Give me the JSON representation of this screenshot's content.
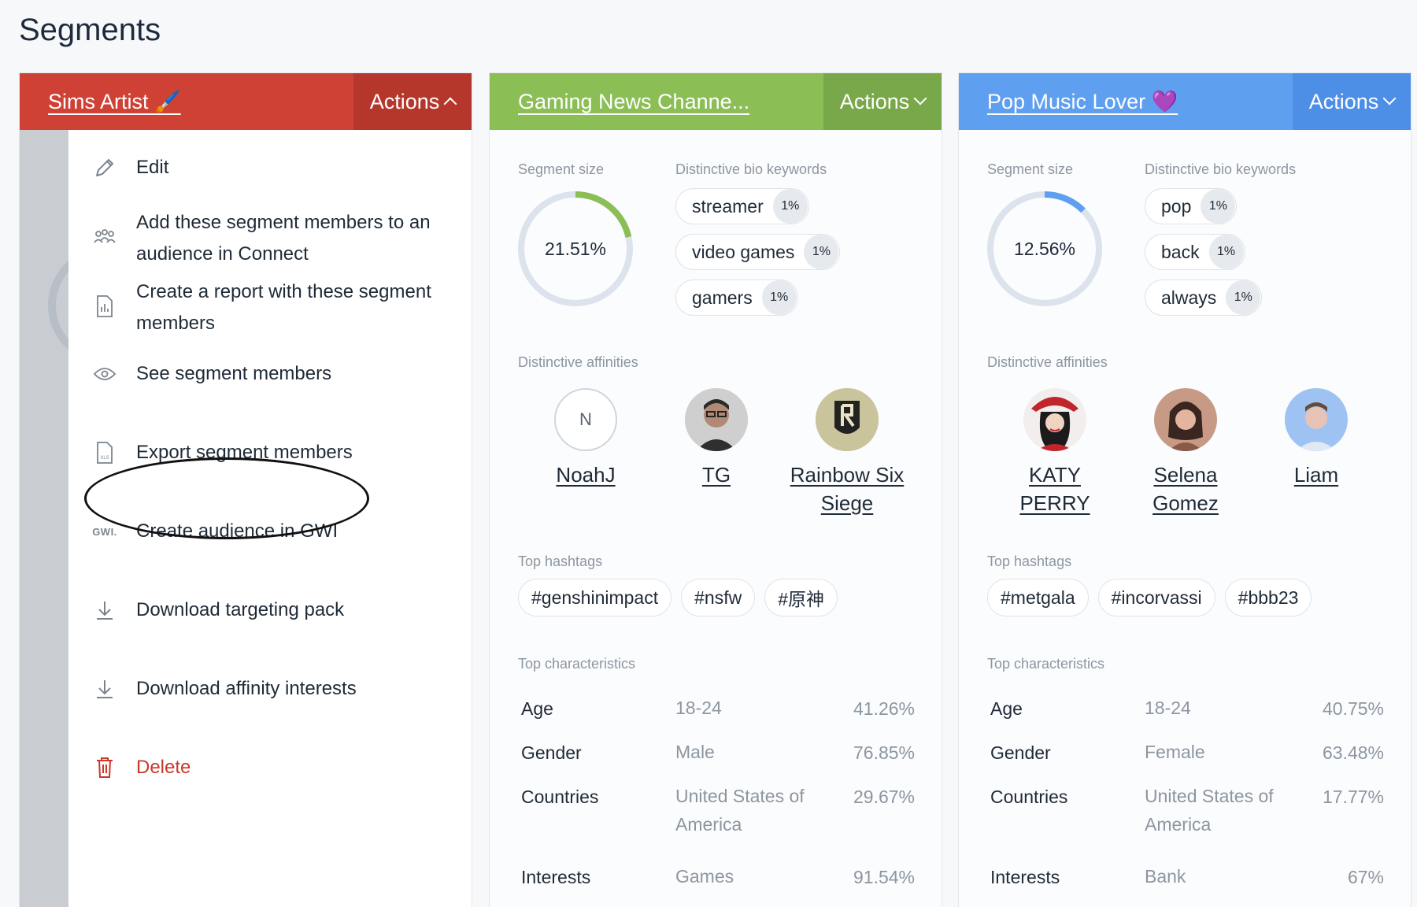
{
  "page": {
    "title": "Segments"
  },
  "cards": [
    {
      "name": "Sims Artist 🖌️",
      "actions": "Actions",
      "color": "#cf4134"
    },
    {
      "name": "Gaming News Channe...",
      "actions": "Actions",
      "color": "#8cbe56",
      "segment_size_label": "Segment size",
      "segment_size": "21.51%",
      "segment_fraction": 0.2151,
      "keywords_label": "Distinctive bio keywords",
      "keywords": [
        {
          "word": "streamer",
          "pct": "1%"
        },
        {
          "word": "video games",
          "pct": "1%"
        },
        {
          "word": "gamers",
          "pct": "1%"
        }
      ],
      "affinities_label": "Distinctive affinities",
      "affinities": [
        {
          "name": "NoahJ",
          "initial": "N",
          "icon": "initial-avatar"
        },
        {
          "name": "TG",
          "icon": "person-avatar"
        },
        {
          "name": "Rainbow Six Siege",
          "icon": "rainbow-six-logo"
        }
      ],
      "hashtags_label": "Top hashtags",
      "hashtags": [
        "#genshinimpact",
        "#nsfw",
        "#原神"
      ],
      "characteristics_label": "Top characteristics",
      "characteristics": [
        {
          "key": "Age",
          "value": "18-24",
          "pct": "41.26%"
        },
        {
          "key": "Gender",
          "value": "Male",
          "pct": "76.85%"
        },
        {
          "key": "Countries",
          "value": "United States of America",
          "pct": "29.67%"
        },
        {
          "key": "Interests",
          "value": "Games",
          "pct": "91.54%"
        }
      ]
    },
    {
      "name": "Pop Music Lover 💜",
      "actions": "Actions",
      "color": "#5f9ff0",
      "segment_size_label": "Segment size",
      "segment_size": "12.56%",
      "segment_fraction": 0.1256,
      "keywords_label": "Distinctive bio keywords",
      "keywords": [
        {
          "word": "pop",
          "pct": "1%"
        },
        {
          "word": "back",
          "pct": "1%"
        },
        {
          "word": "always",
          "pct": "1%"
        }
      ],
      "affinities_label": "Distinctive affinities",
      "affinities": [
        {
          "name": "KATY PERRY",
          "icon": "person-avatar"
        },
        {
          "name": "Selena Gomez",
          "icon": "person-avatar"
        },
        {
          "name": "Liam",
          "icon": "person-avatar"
        }
      ],
      "hashtags_label": "Top hashtags",
      "hashtags": [
        "#metgala",
        "#incorvassi",
        "#bbb23"
      ],
      "characteristics_label": "Top characteristics",
      "characteristics": [
        {
          "key": "Age",
          "value": "18-24",
          "pct": "40.75%"
        },
        {
          "key": "Gender",
          "value": "Female",
          "pct": "63.48%"
        },
        {
          "key": "Countries",
          "value": "United States of America",
          "pct": "17.77%"
        },
        {
          "key": "Interests",
          "value": "Bank",
          "pct": "67%"
        }
      ]
    }
  ],
  "actions_menu": {
    "items": [
      {
        "label": "Edit",
        "icon": "pencil-icon"
      },
      {
        "label": "Add these segment members to an audience in Connect",
        "icon": "people-icon"
      },
      {
        "label": "Create a report with these segment members",
        "icon": "report-icon"
      },
      {
        "label": "See segment members",
        "icon": "eye-icon"
      },
      {
        "label": "Export segment members",
        "icon": "xls-file-icon"
      },
      {
        "label": "Create audience in GWI",
        "icon": "gwi-icon",
        "icon_text": "GWI."
      },
      {
        "label": "Download targeting pack",
        "icon": "download-icon"
      },
      {
        "label": "Download affinity interests",
        "icon": "download-icon"
      },
      {
        "label": "Delete",
        "icon": "trash-icon"
      }
    ]
  },
  "colors": {
    "donut_track": "#dce3ec",
    "delete": "#c8392c"
  }
}
